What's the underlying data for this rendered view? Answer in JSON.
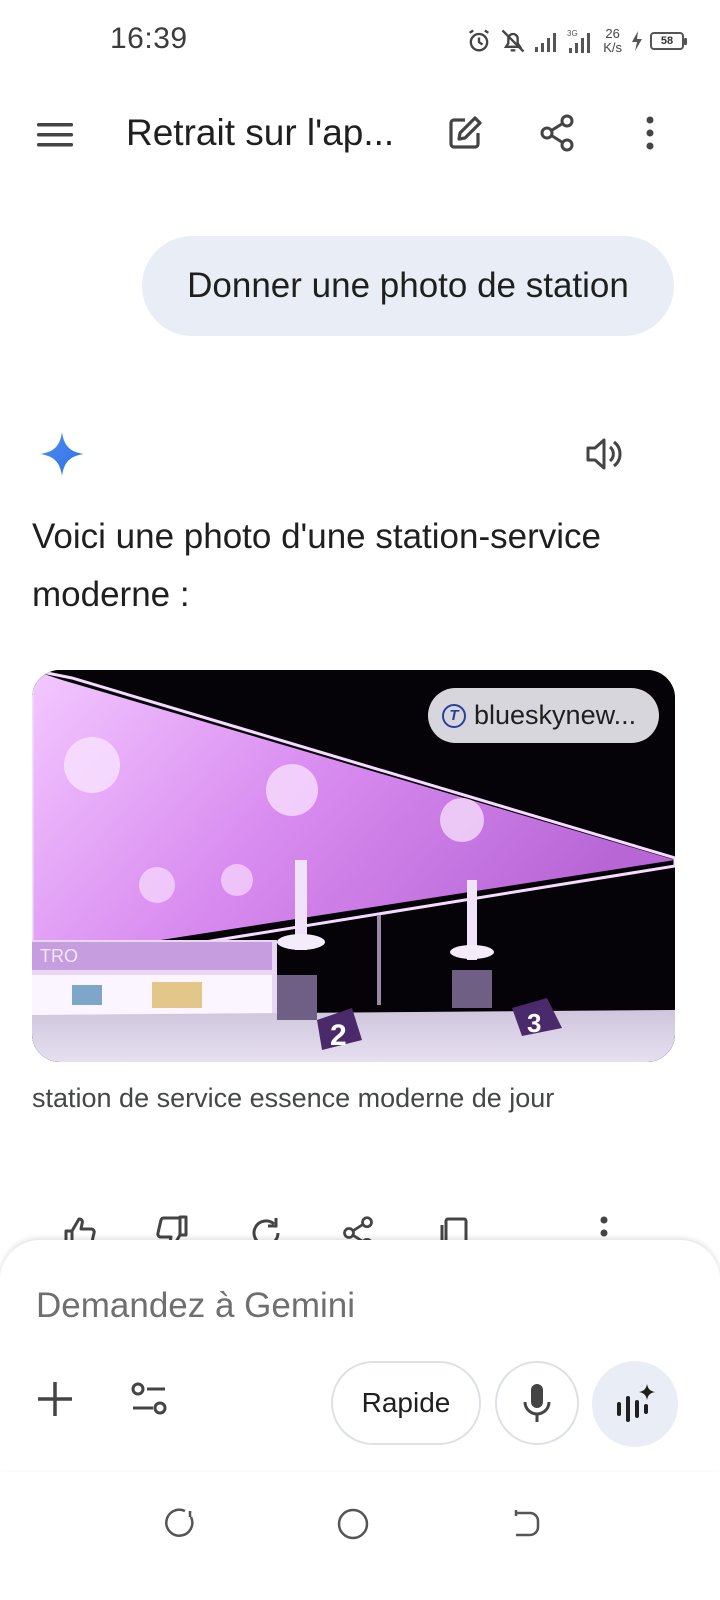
{
  "status_bar": {
    "time": "16:39",
    "net_speed_value": "26",
    "net_speed_unit": "K/s",
    "battery": "58",
    "icons": [
      "alarm-icon",
      "bell-off-icon",
      "signal-icon",
      "signal-3g-icon",
      "charging-icon",
      "battery-icon"
    ]
  },
  "app_bar": {
    "title": "Retrait sur l'ap...",
    "icons": [
      "menu-icon",
      "edit-icon",
      "share-icon",
      "more-vert-icon"
    ]
  },
  "conversation": {
    "user_message": "Donner une photo de station",
    "response_text": "Voici une photo d'une station-service moderne :",
    "image": {
      "source_label": "blueskynew...",
      "source_logo": "T",
      "caption": "station de service essence moderne de jour",
      "sign_text": "TRO",
      "pump_numbers": [
        "2",
        "3"
      ]
    },
    "action_icons": [
      "thumb-up-icon",
      "thumb-down-icon",
      "regenerate-icon",
      "share-icon",
      "copy-icon",
      "more-vert-icon"
    ]
  },
  "composer": {
    "placeholder": "Demandez à Gemini",
    "model_button": "Rapide",
    "icons": [
      "plus-icon",
      "tools-icon",
      "mic-icon",
      "live-icon"
    ]
  },
  "colors": {
    "bubble": "#e9eef6",
    "gemini_blue": "#4285f4",
    "canopy_purple": "#d98cf0"
  }
}
